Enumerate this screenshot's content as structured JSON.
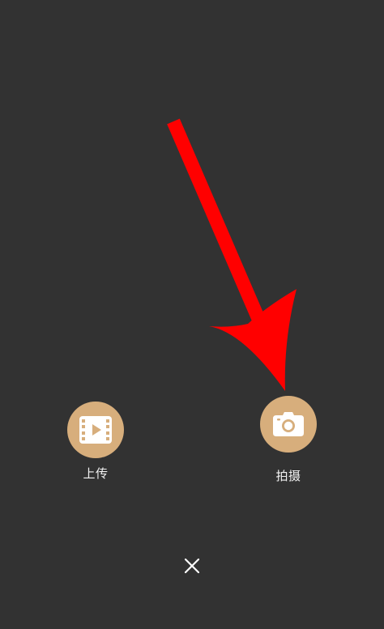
{
  "colors": {
    "background": "#323232",
    "button_fill": "#d7ae7c",
    "icon_fill": "#ffffff",
    "label_text": "#f2f2f2",
    "annotation_arrow": "#ff0000"
  },
  "actions": {
    "upload": {
      "label": "上传",
      "icon": "video-film-icon"
    },
    "capture": {
      "label": "拍摄",
      "icon": "camera-icon"
    }
  },
  "close": {
    "icon": "close-icon"
  },
  "annotation": {
    "icon": "red-arrow-pointing-to-capture"
  }
}
